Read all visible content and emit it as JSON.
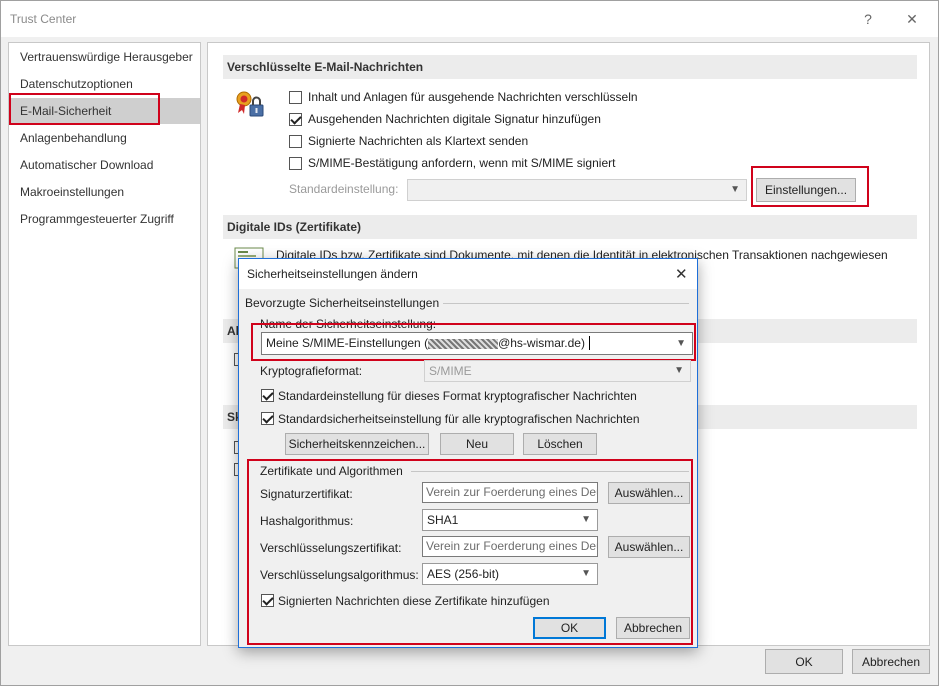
{
  "window": {
    "title": "Trust Center",
    "help_glyph": "?",
    "close_glyph": "✕",
    "ok_label": "OK",
    "cancel_label": "Abbrechen"
  },
  "sidebar": {
    "items": [
      {
        "label": "Vertrauenswürdige Herausgeber"
      },
      {
        "label": "Datenschutzoptionen"
      },
      {
        "label": "E-Mail-Sicherheit"
      },
      {
        "label": "Anlagenbehandlung"
      },
      {
        "label": "Automatischer Download"
      },
      {
        "label": "Makroeinstellungen"
      },
      {
        "label": "Programmgesteuerter Zugriff"
      }
    ],
    "selected": "E-Mail-Sicherheit"
  },
  "main": {
    "encrypted_section": {
      "header": "Verschlüsselte E-Mail-Nachrichten",
      "options": [
        {
          "label": "Inhalt und Anlagen für ausgehende Nachrichten verschlüsseln",
          "checked": false
        },
        {
          "label": "Ausgehenden Nachrichten digitale Signatur hinzufügen",
          "checked": true
        },
        {
          "label": "Signierte Nachrichten als Klartext senden",
          "checked": false
        },
        {
          "label": "S/MIME-Bestätigung anfordern, wenn mit S/MIME signiert",
          "checked": false
        }
      ],
      "default_setting_label": "Standardeinstellung:",
      "default_setting_value": "",
      "settings_button": "Einstellungen..."
    },
    "digital_ids_section": {
      "header": "Digitale IDs (Zertifikate)",
      "description": "Digitale IDs bzw. Zertifikate sind Dokumente, mit denen die Identität in elektronischen Transaktionen nachgewiesen"
    },
    "partial_header_1": "Al",
    "partial_header_2": "Sk"
  },
  "dialog": {
    "title": "Sicherheitseinstellungen ändern",
    "close_glyph": "✕",
    "preferred_group": "Bevorzugte Sicherheitseinstellungen",
    "name_label": "Name der Sicherheitseinstellung:",
    "name_value": "Meine S/MIME-Einstellungen (",
    "name_value_suffix": "@hs-wismar.de)",
    "crypto_format_label": "Kryptografieformat:",
    "crypto_format_value": "S/MIME",
    "default_for_format": {
      "label": "Standardeinstellung für dieses Format kryptografischer Nachrichten",
      "checked": true
    },
    "default_for_all": {
      "label": "Standardsicherheitseinstellung für alle kryptografischen Nachrichten",
      "checked": true
    },
    "security_labels_button": "Sicherheitskennzeichen...",
    "new_button": "Neu",
    "delete_button": "Löschen",
    "cert_group": "Zertifikate und Algorithmen",
    "signing_cert_label": "Signaturzertifikat:",
    "signing_cert_value": "Verein zur Foerderung eines Deut",
    "choose_button": "Auswählen...",
    "hash_label": "Hashalgorithmus:",
    "hash_value": "SHA1",
    "enc_cert_label": "Verschlüsselungszertifikat:",
    "enc_cert_value": "Verein zur Foerderung eines Deut",
    "enc_alg_label": "Verschlüsselungsalgorithmus:",
    "enc_alg_value": "AES (256-bit)",
    "add_certs": {
      "label": "Signierten Nachrichten diese Zertifikate hinzufügen",
      "checked": true
    },
    "ok_label": "OK",
    "cancel_label": "Abbrechen"
  },
  "colors": {
    "highlight_red": "#d0021b",
    "focus_blue": "#0078d7",
    "selected_sidebar": "#cfcfcf"
  }
}
